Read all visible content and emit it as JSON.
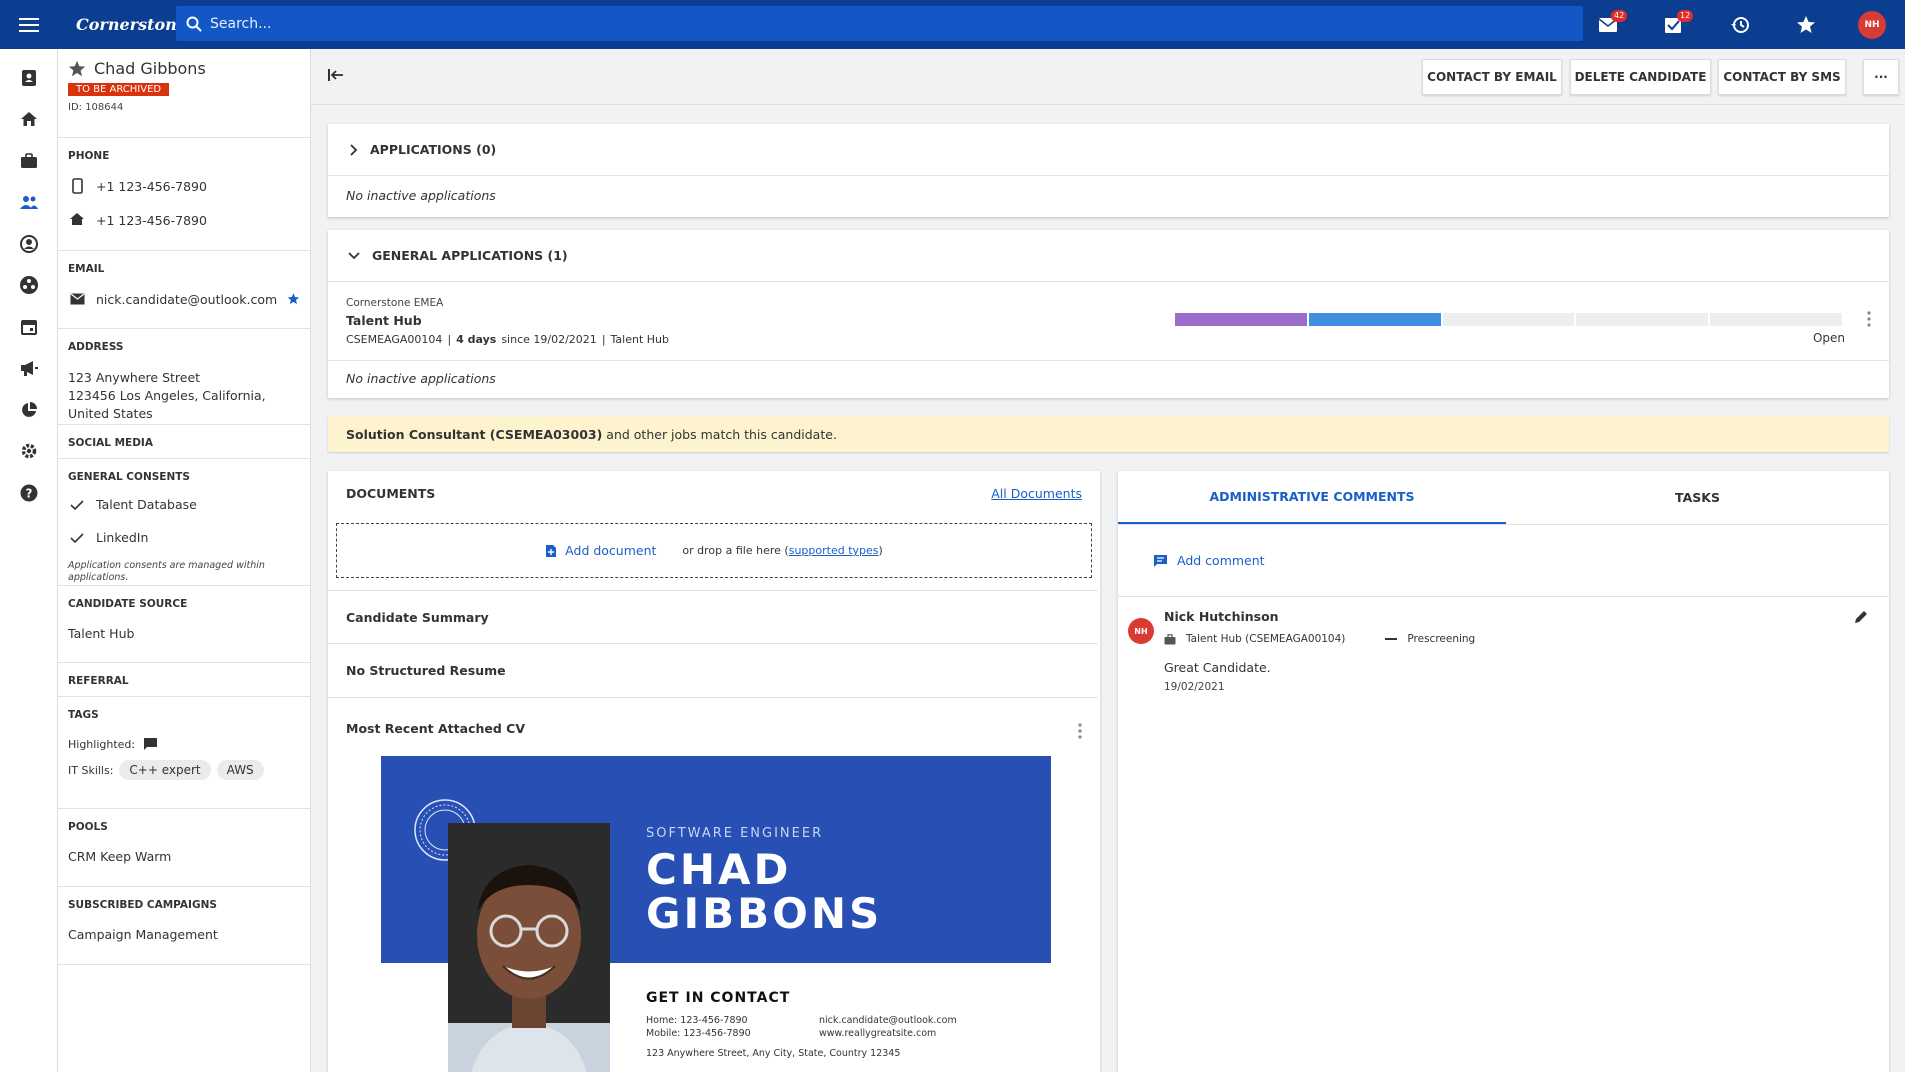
{
  "topbar": {
    "logo": "Cornerstone",
    "search_placeholder": "Search...",
    "mail_badge": "42",
    "tasks_badge": "12",
    "user_initials": "NH"
  },
  "candidate": {
    "name": "Chad Gibbons",
    "status": "TO BE ARCHIVED",
    "id": "ID: 108644",
    "phone_title": "PHONE",
    "mobile": "+1 123-456-7890",
    "home_phone": "+1 123-456-7890",
    "email_title": "EMAIL",
    "email": "nick.candidate@outlook.com",
    "address_title": "ADDRESS",
    "address_line1": "123 Anywhere Street",
    "address_line2": "123456 Los Angeles, California, United States",
    "social_title": "SOCIAL MEDIA",
    "consents_title": "GENERAL CONSENTS",
    "consent1": "Talent Database",
    "consent2": "LinkedIn",
    "consents_note": "Application consents are managed within applications.",
    "source_title": "CANDIDATE SOURCE",
    "source": "Talent Hub",
    "referral_title": "REFERRAL",
    "tags_title": "TAGS",
    "tag_highlighted": "Highlighted:",
    "tag_it_skills": "IT Skills:",
    "skill1": "C++ expert",
    "skill2": "AWS",
    "pools_title": "POOLS",
    "pool": "CRM Keep Warm",
    "campaigns_title": "SUBSCRIBED CAMPAIGNS",
    "campaign": "Campaign Management"
  },
  "actions": {
    "contact_email": "CONTACT BY EMAIL",
    "delete": "DELETE CANDIDATE",
    "contact_sms": "CONTACT BY SMS",
    "more": "···"
  },
  "applications": {
    "title": "APPLICATIONS (0)",
    "empty": "No inactive applications"
  },
  "general_applications": {
    "title": "GENERAL APPLICATIONS (1)",
    "org": "Cornerstone EMEA",
    "name": "Talent Hub",
    "code": "CSEMEAGA00104",
    "days": "4 days",
    "since": "since 19/02/2021",
    "source": "Talent Hub",
    "status": "Open",
    "empty": "No inactive applications"
  },
  "banner": {
    "job": "Solution Consultant (CSEMEA03003)",
    "rest": "and other jobs match this candidate."
  },
  "documents": {
    "title": "DOCUMENTS",
    "all_link": "All Documents",
    "add": "Add document",
    "drop_prefix": "or drop a file here (",
    "drop_link": "supported types",
    "drop_suffix": ")",
    "summary": "Candidate Summary",
    "resume": "No Structured Resume",
    "cv_title": "Most Recent Attached CV"
  },
  "cv": {
    "role": "SOFTWARE ENGINEER",
    "first": "CHAD",
    "last": "GIBBONS",
    "contact_title": "GET IN CONTACT",
    "home": "Home: 123-456-7890",
    "mobile": "Mobile: 123-456-7890",
    "email": "nick.candidate@outlook.com",
    "site": "www.reallygreatsite.com",
    "address": "123 Anywhere Street, Any City, State, Country 12345"
  },
  "comments": {
    "tab_admin": "ADMINISTRATIVE COMMENTS",
    "tab_tasks": "TASKS",
    "add": "Add comment",
    "author": "Nick Hutchinson",
    "author_initials": "NH",
    "context": "Talent Hub (CSEMEAGA00104)",
    "stage": "Prescreening",
    "text": "Great Candidate.",
    "date": "19/02/2021"
  },
  "progress": {
    "segments": [
      {
        "color": "#9b6cc9",
        "fraction": 0.2
      },
      {
        "color": "#3f8ee0",
        "fraction": 0.2
      },
      {
        "color": "#eeeeee",
        "fraction": 0.2
      },
      {
        "color": "#eeeeee",
        "fraction": 0.2
      },
      {
        "color": "#eeeeee",
        "fraction": 0.2
      }
    ]
  }
}
